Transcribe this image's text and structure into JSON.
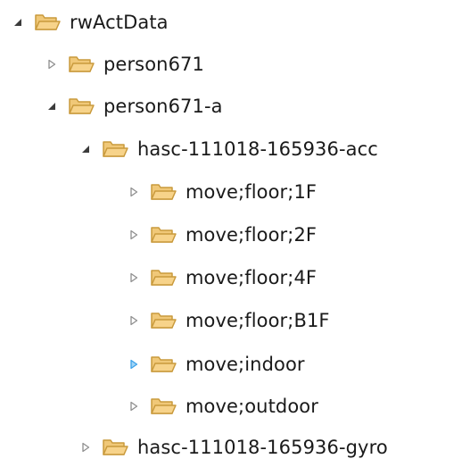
{
  "colors": {
    "text": "#1a1a1a",
    "expanded_arrow": "#3b3b3b",
    "collapsed_arrow": "#8f8f8f",
    "hover_arrow": "#3ea1e8",
    "folder_fill": "#f7d38a",
    "folder_stroke": "#c99a3c"
  },
  "tree": {
    "nodes": [
      {
        "label": "rwActData",
        "state": "expanded",
        "icon": "folder-open-icon"
      },
      {
        "label": "person671",
        "state": "collapsed",
        "icon": "folder-open-icon"
      },
      {
        "label": "person671-a",
        "state": "expanded",
        "icon": "folder-open-icon"
      },
      {
        "label": "hasc-111018-165936-acc",
        "state": "expanded",
        "icon": "folder-open-icon"
      },
      {
        "label": "move;floor;1F",
        "state": "collapsed",
        "icon": "folder-open-icon"
      },
      {
        "label": "move;floor;2F",
        "state": "collapsed",
        "icon": "folder-open-icon"
      },
      {
        "label": "move;floor;4F",
        "state": "collapsed",
        "icon": "folder-open-icon"
      },
      {
        "label": "move;floor;B1F",
        "state": "collapsed",
        "icon": "folder-open-icon"
      },
      {
        "label": "move;indoor",
        "state": "collapsed-hover",
        "icon": "folder-open-icon"
      },
      {
        "label": "move;outdoor",
        "state": "collapsed",
        "icon": "folder-open-icon"
      },
      {
        "label": "hasc-111018-165936-gyro",
        "state": "collapsed",
        "icon": "folder-open-icon"
      }
    ]
  }
}
